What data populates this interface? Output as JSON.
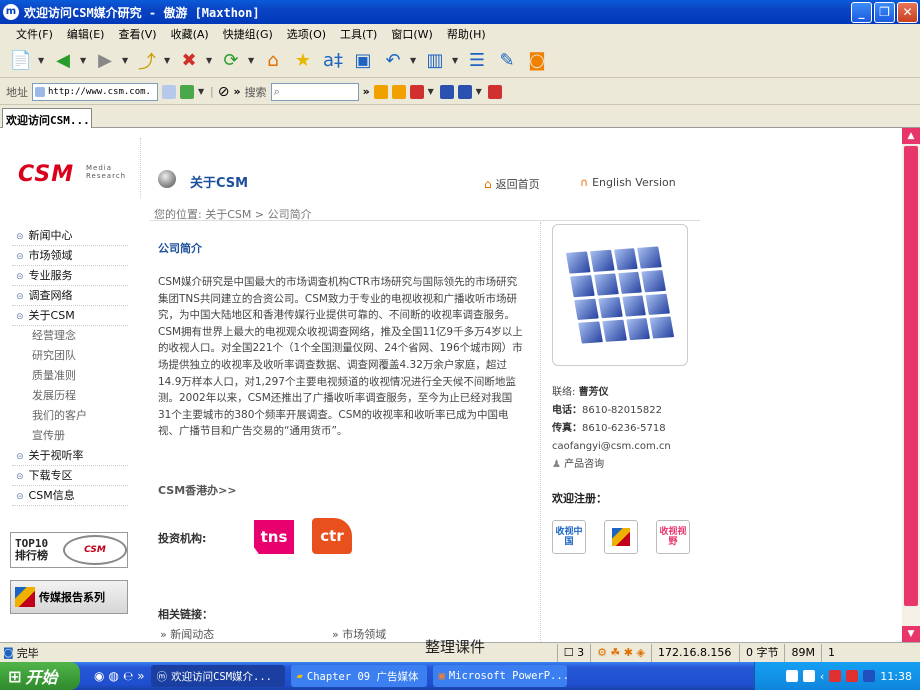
{
  "window": {
    "title": "欢迎访问CSM媒介研究 - 傲游 [Maxthon]",
    "controls": [
      "_",
      "❐",
      "✕"
    ]
  },
  "menu": [
    "文件(F)",
    "编辑(E)",
    "查看(V)",
    "收藏(A)",
    "快捷组(G)",
    "选项(O)",
    "工具(T)",
    "窗口(W)",
    "帮助(H)"
  ],
  "address": {
    "label": "地址",
    "url": "http://www.csm.com.",
    "search_label": "搜索"
  },
  "tab": {
    "label": "欢迎访问CSM..."
  },
  "page": {
    "logo_text": "CSM",
    "logo_sub": "Media Research",
    "about_title": "关于CSM",
    "home_link": "返回首页",
    "english_link": "English Version",
    "breadcrumb": "您的位置: 关于CSM > 公司简介",
    "nav": [
      {
        "label": "新闻中心",
        "type": "main"
      },
      {
        "label": "市场领域",
        "type": "main"
      },
      {
        "label": "专业服务",
        "type": "main"
      },
      {
        "label": "调查网络",
        "type": "main"
      },
      {
        "label": "关于CSM",
        "type": "main"
      },
      {
        "label": "经营理念",
        "type": "sub"
      },
      {
        "label": "研究团队",
        "type": "sub"
      },
      {
        "label": "质量准则",
        "type": "sub"
      },
      {
        "label": "发展历程",
        "type": "sub"
      },
      {
        "label": "我们的客户",
        "type": "sub"
      },
      {
        "label": "宣传册",
        "type": "sub"
      },
      {
        "label": "关于视听率",
        "type": "main"
      },
      {
        "label": "下载专区",
        "type": "main"
      },
      {
        "label": "CSM信息",
        "type": "main"
      }
    ],
    "badge_top10": "TOP10 排行榜",
    "badge_stamp": "CSM",
    "badge_report": "传媒报告系列",
    "section_title": "公司简介",
    "intro": "CSM媒介研究是中国最大的市场调查机构CTR市场研究与国际领先的市场研究集团TNS共同建立的合资公司。CSM致力于专业的电视收视和广播收听市场研究，为中国大陆地区和香港传媒行业提供可靠的、不间断的收视率调查服务。CSM拥有世界上最大的电视观众收视调查网络，推及全国11亿9千多万4岁以上的收视人口。对全国221个（1个全国测量仪网、24个省网、196个城市网）市场提供独立的收视率及收听率调查数据、调查网覆盖4.32万余户家庭，超过14.9万样本人口，对1,297个主要电视频道的收视情况进行全天候不间断地监测。2002年以来，CSM还推出了广播收听率调查服务，至今为止已经对我国31个主要城市的380个频率开展调查。CSM的收视率和收听率已成为中国电视、广播节目和广告交易的“通用货币”。",
    "hk_link": "CSM香港办>>",
    "invest_label": "投资机构:",
    "investors": [
      "tns",
      "ctr"
    ],
    "related_title": "相关链接：",
    "related_links": [
      "新闻动态",
      "市场领域"
    ],
    "contact": {
      "name_label": "联络:",
      "name": "曹芳仪",
      "phone_label": "电话：",
      "phone": "8610-82015822",
      "fax_label": "传真：",
      "fax": "8610-6236-5718",
      "email": "caofangyi@csm.com.cn",
      "consult": "产品咨询"
    },
    "welcome": "欢迎注册：",
    "channels": [
      "收视中国",
      "",
      "收视视野"
    ]
  },
  "status": {
    "left": "完毕",
    "watermark": "整理课件",
    "count": "3",
    "ip": "172.16.8.156",
    "bytes": "0 字节",
    "mem": "89M",
    "page": "1"
  },
  "taskbar": {
    "start": "开始",
    "tasks": [
      "欢迎访问CSM媒介...",
      "Chapter 09 广告媒体",
      "Microsoft PowerP..."
    ],
    "clock": "11:38"
  },
  "colors": {
    "brand": "#d8001a",
    "accent": "#e8366b",
    "link": "#1d4f9c"
  }
}
